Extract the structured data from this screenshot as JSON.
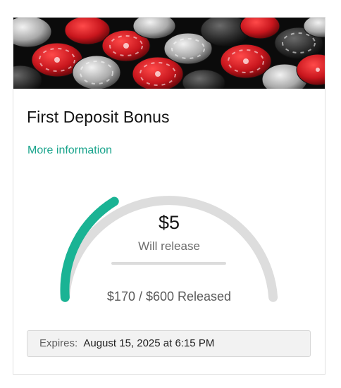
{
  "card": {
    "title": "First Deposit Bonus",
    "more_info_label": "More information"
  },
  "progress": {
    "amount": "$5",
    "will_release_label": "Will release",
    "released_text": "$170 / $600 Released",
    "released_value": 170,
    "target_value": 600,
    "released_fraction": 0.2833,
    "color_filled": "#1ab394",
    "color_track": "#dddddd"
  },
  "expiry": {
    "label": "Expires:",
    "value": "August 15, 2025 at 6:15 PM"
  },
  "banner": {
    "icon": "poker-chips-image",
    "chip_colors": [
      "#d01e25",
      "#b8b8b8",
      "#3a3a3a"
    ]
  }
}
